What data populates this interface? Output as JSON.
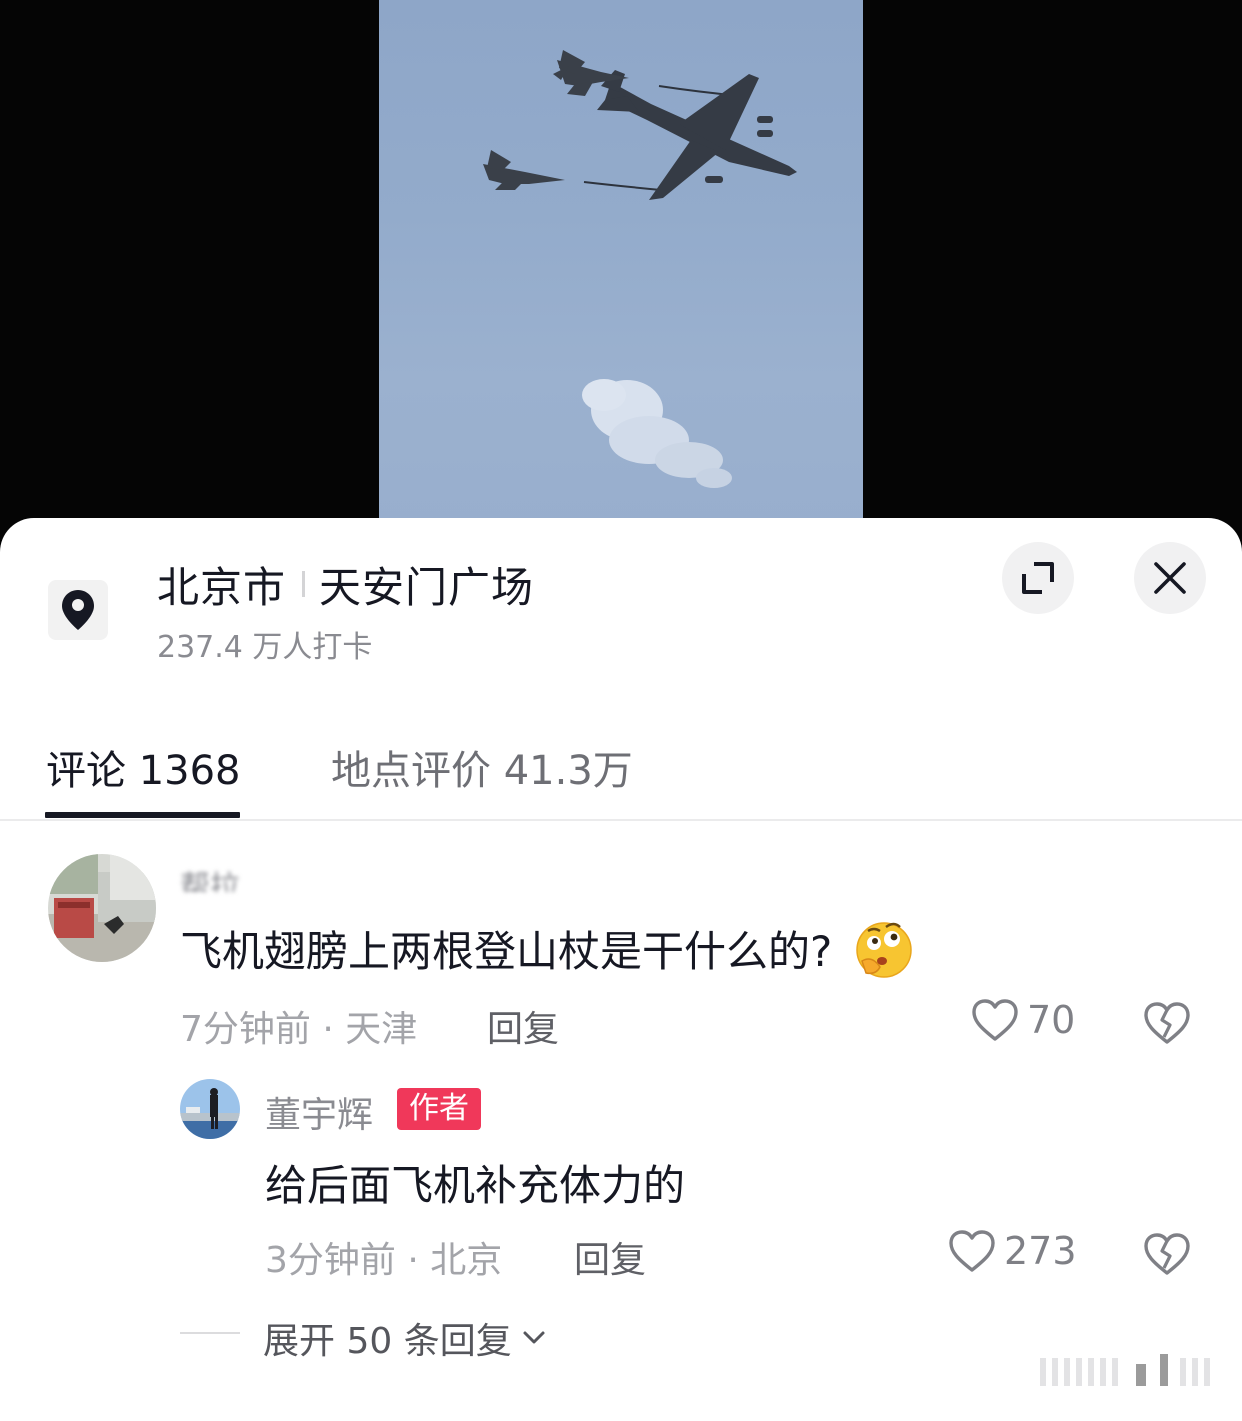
{
  "location": {
    "city": "北京市",
    "place": "天安门广场",
    "checkins": "237.4 万人打卡",
    "icon": "map-pin-icon"
  },
  "actions": {
    "expand_icon": "expand-icon",
    "close_icon": "close-icon"
  },
  "tabs": [
    {
      "label": "评论 1368",
      "active": true
    },
    {
      "label": "地点评价 41.3万",
      "active": false
    }
  ],
  "comments": [
    {
      "username": "帮拉",
      "text": "飞机翅膀上两根登山杖是干什么的?",
      "emoji": "thinking-face-emoji",
      "time_location": "7分钟前 · 天津",
      "reply_label": "回复",
      "likes": "70",
      "replies": [
        {
          "username": "董宇辉",
          "badge": "作者",
          "text": "给后面飞机补充体力的",
          "time_location": "3分钟前 · 北京",
          "reply_label": "回复",
          "likes": "273"
        }
      ],
      "expand_label": "展开 50 条回复"
    }
  ],
  "colors": {
    "accent_badge": "#f0385a",
    "text_primary": "#161823",
    "text_secondary": "#8a8b91"
  }
}
